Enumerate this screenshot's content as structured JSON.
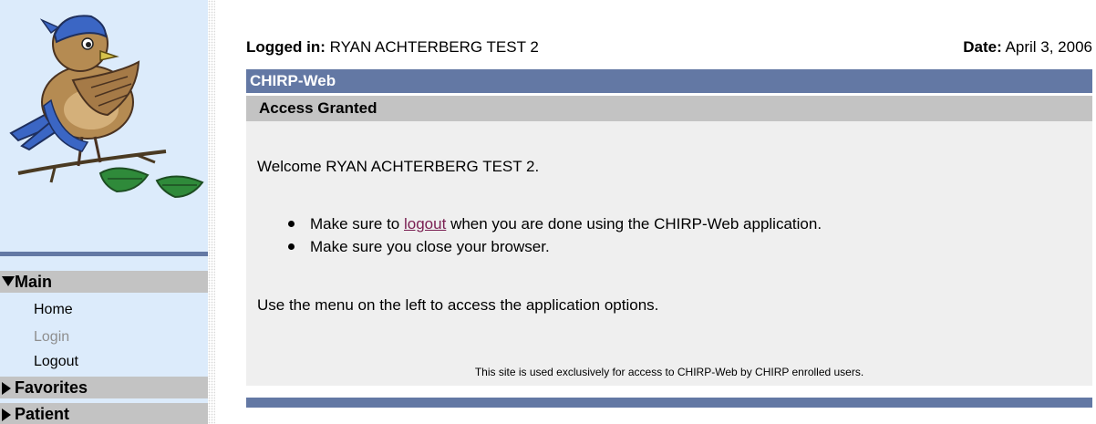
{
  "header": {
    "logged_in_label": "Logged in:",
    "logged_in_user": "RYAN ACHTERBERG TEST 2",
    "date_label": "Date:",
    "date_value": "April 3, 2006"
  },
  "app_bar": {
    "title": "CHIRP-Web"
  },
  "section": {
    "title": "Access Granted"
  },
  "content": {
    "welcome": "Welcome RYAN ACHTERBERG TEST 2.",
    "bullet1_prefix": "Make sure to",
    "bullet1_link": "logout",
    "bullet1_suffix": "when you are done using the CHIRP-Web application.",
    "bullet2": "Make sure you close your browser.",
    "menu_note": "Use the menu on the left to access the application options.",
    "footer": "This site is used exclusively for access to CHIRP-Web by CHIRP enrolled users."
  },
  "sidebar": {
    "logo_icon": "bird-mascot-icon",
    "sections": [
      {
        "label": "Main",
        "expanded": true
      },
      {
        "label": "Favorites",
        "expanded": false
      },
      {
        "label": "Patient",
        "expanded": false
      }
    ],
    "main_items": [
      {
        "label": "Home",
        "enabled": true
      },
      {
        "label": "Login",
        "enabled": false
      },
      {
        "label": "Logout",
        "enabled": true
      }
    ]
  },
  "colors": {
    "bar_blue": "#6378a4",
    "bar_gray": "#c3c3c3",
    "sidebar_bg": "#dcebfb",
    "content_bg": "#efefef",
    "link_visited": "#7a1f52",
    "disabled_text": "#8e8e8e"
  }
}
